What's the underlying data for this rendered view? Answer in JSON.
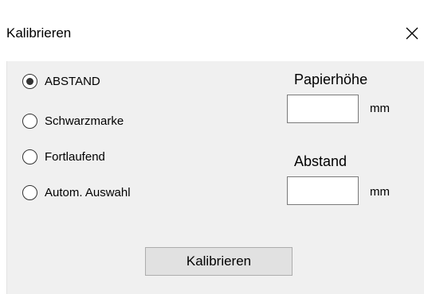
{
  "window": {
    "title": "Kalibrieren",
    "close_icon": "close-icon"
  },
  "mode": {
    "options": [
      {
        "label": "ABSTAND",
        "checked": true
      },
      {
        "label": "Schwarzmarke",
        "checked": false
      },
      {
        "label": "Fortlaufend",
        "checked": false
      },
      {
        "label": "Autom. Auswahl",
        "checked": false
      }
    ]
  },
  "fields": {
    "paper_height": {
      "label": "Papierhöhe",
      "value": "",
      "unit": "mm"
    },
    "gap": {
      "label": "Abstand",
      "value": "",
      "unit": "mm"
    }
  },
  "actions": {
    "calibrate_label": "Kalibrieren"
  }
}
